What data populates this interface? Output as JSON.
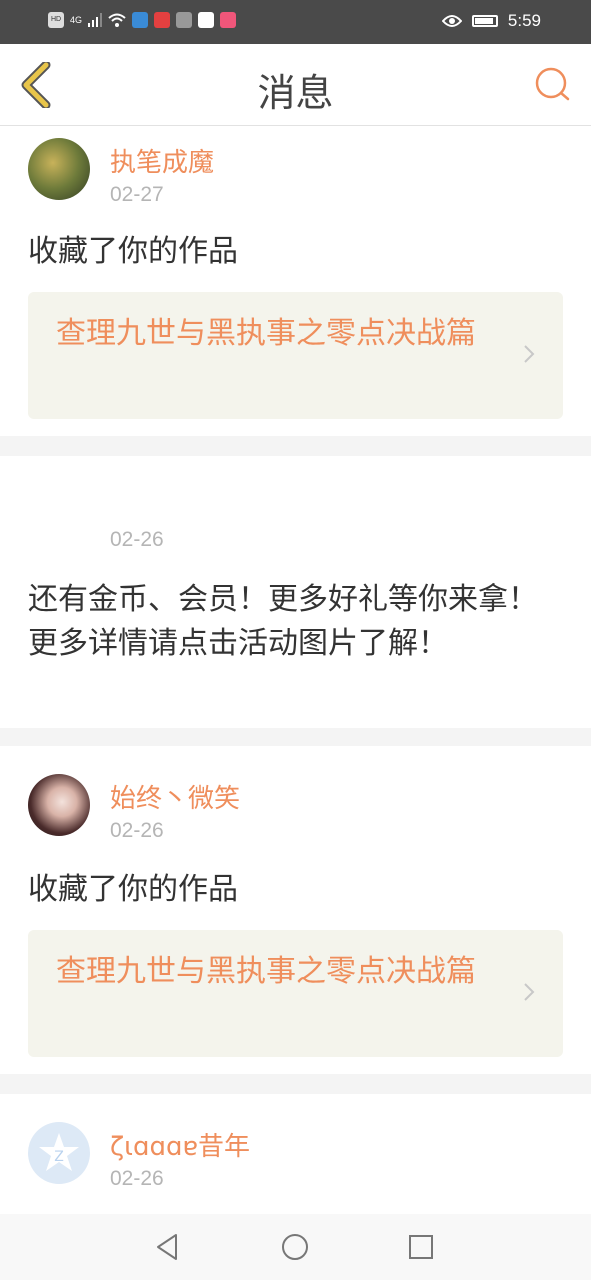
{
  "status": {
    "left_icons": [
      "HD",
      "4G",
      "signal",
      "wifi",
      "app-badge-1",
      "toutiao",
      "wechat",
      "video-app",
      "video-app-2"
    ],
    "time": "5:59"
  },
  "header": {
    "title": "消息"
  },
  "messages": [
    {
      "user": "执笔成魔",
      "date": "02-27",
      "text": "收藏了你的作品",
      "work_title": "查理九世与黑执事之零点决战篇"
    },
    {
      "user": "",
      "date": "02-26",
      "text": "还有金币、会员！更多好礼等你来拿！\n更多详情请点击活动图片了解！"
    },
    {
      "user": "始终丶微笑",
      "date": "02-26",
      "text": "收藏了你的作品",
      "work_title": "查理九世与黑执事之零点决战篇"
    },
    {
      "user": "ζιɑɑɑɐ昔年",
      "date": "02-26"
    }
  ],
  "colors": {
    "accent": "#ef8e5c",
    "back_icon": "#e8c54a",
    "work_bg": "#f4f4ec"
  }
}
